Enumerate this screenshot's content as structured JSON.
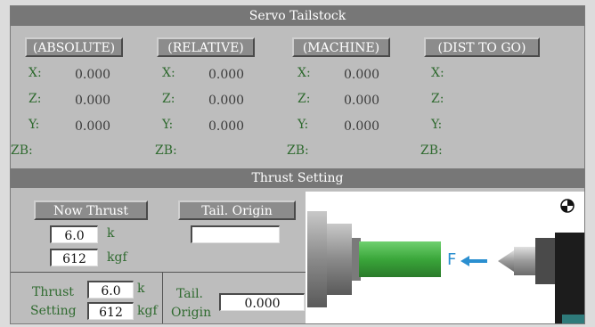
{
  "title": "Servo Tailstock",
  "positions": [
    {
      "header": "(ABSOLUTE)",
      "rows": [
        {
          "axis": "X:",
          "value": "0.000"
        },
        {
          "axis": "Z:",
          "value": "0.000"
        },
        {
          "axis": "Y:",
          "value": "0.000"
        },
        {
          "axis": "ZB:",
          "value": ""
        }
      ]
    },
    {
      "header": "(RELATIVE)",
      "rows": [
        {
          "axis": "X:",
          "value": "0.000"
        },
        {
          "axis": "Z:",
          "value": "0.000"
        },
        {
          "axis": "Y:",
          "value": "0.000"
        },
        {
          "axis": "ZB:",
          "value": ""
        }
      ]
    },
    {
      "header": "(MACHINE)",
      "rows": [
        {
          "axis": "X:",
          "value": "0.000"
        },
        {
          "axis": "Z:",
          "value": "0.000"
        },
        {
          "axis": "Y:",
          "value": "0.000"
        },
        {
          "axis": "ZB:",
          "value": ""
        }
      ]
    },
    {
      "header": "(DIST TO GO)",
      "rows": [
        {
          "axis": "X:",
          "value": ""
        },
        {
          "axis": "Z:",
          "value": ""
        },
        {
          "axis": "Y:",
          "value": ""
        },
        {
          "axis": "ZB:",
          "value": ""
        }
      ]
    }
  ],
  "thrust_title": "Thrust Setting",
  "now_thrust": {
    "label": "Now Thrust",
    "k_value": "6.0",
    "k_unit": "k",
    "kgf_value": "612",
    "kgf_unit": "kgf"
  },
  "tail_origin_btn": {
    "label": "Tail. Origin",
    "value": ""
  },
  "thrust_setting": {
    "label_line1": "Thrust",
    "label_line2": "Setting",
    "k_value": "6.0",
    "k_unit": "k",
    "kgf_value": "612",
    "kgf_unit": "kgf"
  },
  "tail_origin_input": {
    "label_line1": "Tail.",
    "label_line2": "Origin",
    "value": "0.000"
  },
  "diagram": {
    "force_label": "F",
    "accent_color": "#2b8fd0",
    "workpiece_color": "#3aa63a"
  }
}
